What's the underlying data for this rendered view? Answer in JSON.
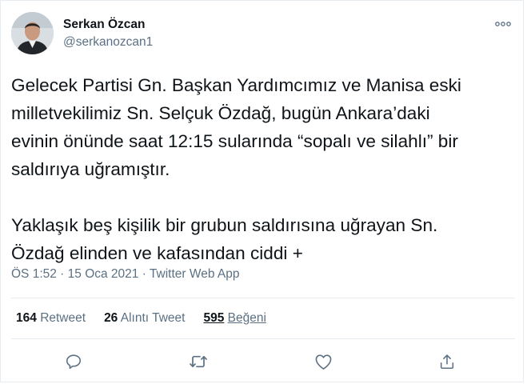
{
  "author": {
    "name": "Serkan Özcan",
    "handle": "@serkanozcan1",
    "avatar_icon": "user-photo"
  },
  "tweet": {
    "paragraph_1": "Gelecek Partisi Gn. Başkan Yardımcımız ve Manisa eski\nmilletvekilimiz Sn. Selçuk Özdağ, bugün Ankara’daki\nevinin önünde saat 12:15 sularında “sopalı ve silahlı” bir\nsaldırıya uğramıştır.",
    "paragraph_2": "Yaklaşık beş kişilik bir grubun saldırısına uğrayan Sn.\nÖzdağ elinden ve kafasından ciddi +"
  },
  "meta": {
    "time": "ÖS 1:52",
    "separator_1": " · ",
    "date": "15 Oca 2021",
    "separator_2": " · ",
    "source": "Twitter Web App"
  },
  "stats": {
    "retweets_count": "164",
    "retweets_label": "Retweet",
    "quotes_count": "26",
    "quotes_label": "Alıntı Tweet",
    "likes_count": "595",
    "likes_label": "Beğeni"
  },
  "actions": {
    "reply_icon": "reply-icon",
    "retweet_icon": "retweet-icon",
    "like_icon": "like-icon",
    "share_icon": "share-icon"
  },
  "colors": {
    "text_primary": "#0f1419",
    "text_secondary": "#5b7083",
    "border": "#e6ecf0"
  }
}
